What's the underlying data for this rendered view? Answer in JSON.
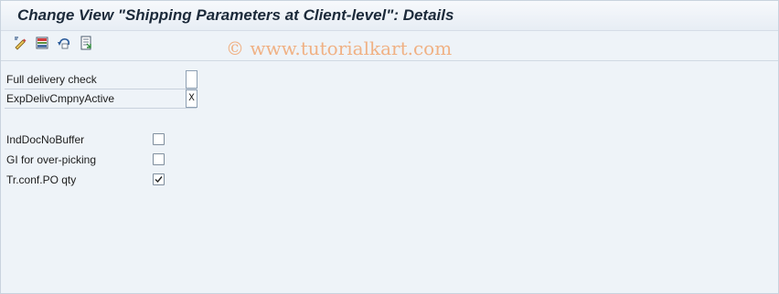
{
  "window": {
    "title": "Change View \"Shipping Parameters at Client-level\": Details"
  },
  "toolbar": {
    "buttons": [
      {
        "icon": "display-change-icon"
      },
      {
        "icon": "save-variant-icon"
      },
      {
        "icon": "undo-icon"
      },
      {
        "icon": "select-block-icon"
      }
    ]
  },
  "watermark": "© www.tutorialkart.com",
  "fields": {
    "full_delivery_check": {
      "label": "Full delivery check",
      "value": ""
    },
    "exp_deliv": {
      "label": "ExpDelivCmpnyActive",
      "value": "X"
    }
  },
  "checkboxes": [
    {
      "label": "IndDocNoBuffer",
      "checked": false
    },
    {
      "label": "GI for over-picking",
      "checked": false
    },
    {
      "label": "Tr.conf.PO qty",
      "checked": true
    }
  ]
}
